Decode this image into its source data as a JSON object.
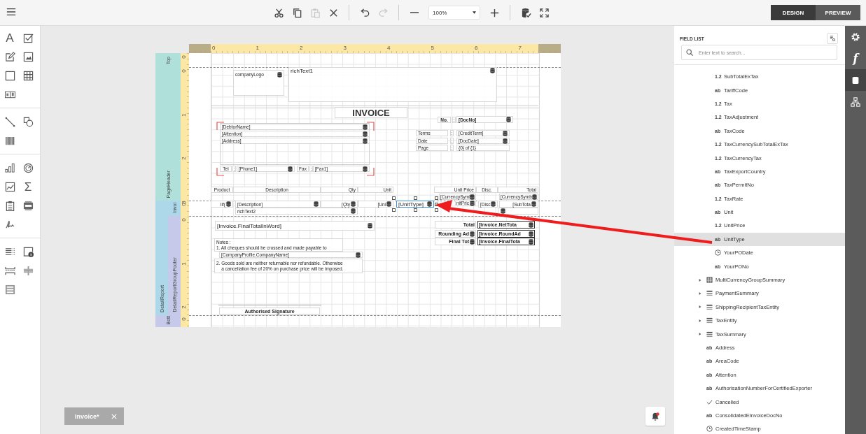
{
  "toolbar": [
    {
      "buttons": [
        {
          "kind": "cut",
          "disabled": false
        },
        {
          "kind": "copy",
          "disabled": false
        },
        {
          "kind": "paste",
          "disabled": true
        },
        {
          "kind": "delete",
          "disabled": false
        }
      ]
    },
    {
      "buttons": [
        {
          "kind": "undo",
          "disabled": false
        },
        {
          "kind": "redo",
          "disabled": true
        }
      ]
    },
    {
      "buttons": [
        {
          "kind": "zoom-out",
          "disabled": false
        },
        {
          "kind": "zoom",
          "value": "100%"
        },
        {
          "kind": "zoom-in",
          "disabled": false
        }
      ]
    },
    {
      "buttons": [
        {
          "kind": "validate",
          "disabled": false
        },
        {
          "kind": "fullscreen",
          "disabled": false
        }
      ]
    }
  ],
  "mode_tabs": [
    {
      "label": "DESIGN",
      "selected": true
    },
    {
      "label": "PREVIEW",
      "selected": false
    }
  ],
  "toolbox": [
    {
      "tools": [
        {
          "kind": "label",
          "glyph": "A"
        },
        {
          "kind": "checkbox"
        },
        {
          "kind": "richtext"
        },
        {
          "kind": "picture"
        },
        {
          "kind": "panel"
        },
        {
          "kind": "table"
        },
        {
          "kind": "comb"
        }
      ]
    },
    {
      "tools": [
        {
          "kind": "line"
        },
        {
          "kind": "shape"
        },
        {
          "kind": "barcode"
        }
      ]
    },
    {
      "tools": [
        {
          "kind": "chart"
        },
        {
          "kind": "gauge"
        },
        {
          "kind": "sparkline"
        },
        {
          "kind": "sum",
          "glyph": "Σ"
        },
        {
          "kind": "clipboard"
        },
        {
          "kind": "pdf"
        },
        {
          "kind": "signature"
        }
      ]
    },
    {
      "tools": [
        {
          "kind": "toc"
        },
        {
          "kind": "info"
        },
        {
          "kind": "pagebreak"
        },
        {
          "kind": "crossline"
        },
        {
          "kind": "crossbox"
        }
      ]
    }
  ],
  "report": {
    "h_ruler": [
      "0",
      "1",
      "2",
      "3",
      "4",
      "5",
      "6",
      "7"
    ],
    "bands": [
      {
        "label": "Top",
        "color": "#b0e0da",
        "ruler": [
          "0"
        ]
      },
      {
        "label": "PageHeader",
        "color": "#b0e0da",
        "ruler": [
          "0",
          "1",
          "2",
          "3"
        ]
      },
      {
        "label": "DetailReport",
        "color": "#acd8ea",
        "children": [
          {
            "label": "Invoi",
            "color": "#acd8ea",
            "ruler": [
              "0"
            ]
          },
          {
            "label": "DetailReportGroupFooter",
            "color": "#c6c9ea",
            "ruler": [
              "0",
              "1",
              "2"
            ]
          }
        ]
      },
      {
        "label": "Bott",
        "color": "#c6c9ea",
        "ruler": [
          "0"
        ]
      }
    ],
    "controls": [
      {
        "text": "companyLogo",
        "bound": true,
        "selected": false
      },
      {
        "text": "richText1",
        "bound": true,
        "selected": false
      },
      {
        "text": "INVOICE",
        "bound": false,
        "selected": false
      },
      {
        "text": "No.",
        "bound": false,
        "selected": false
      },
      {
        "text": ":",
        "bound": false,
        "selected": false
      },
      {
        "text": "[DocNo]",
        "bound": true,
        "selected": false
      },
      {
        "text": "[DebtorName]",
        "bound": true,
        "selected": false
      },
      {
        "text": "[Attention]",
        "bound": true,
        "selected": false
      },
      {
        "text": "[Address]",
        "bound": true,
        "selected": false
      },
      {
        "text": "Terms",
        "bound": false,
        "selected": false
      },
      {
        "text": ":",
        "bound": false,
        "selected": false
      },
      {
        "text": "[CreditTerm]",
        "bound": true,
        "selected": false
      },
      {
        "text": "Date",
        "bound": false,
        "selected": false
      },
      {
        "text": ":",
        "bound": false,
        "selected": false
      },
      {
        "text": "[DocDate]",
        "bound": true,
        "selected": false
      },
      {
        "text": "Page",
        "bound": false,
        "selected": false
      },
      {
        "text": ":",
        "bound": false,
        "selected": false
      },
      {
        "text": "{0} of {1}",
        "bound": false,
        "selected": false
      },
      {
        "text": "Tel",
        "bound": false,
        "selected": false
      },
      {
        "text": ":",
        "bound": false,
        "selected": false
      },
      {
        "text": "[Phone1]",
        "bound": true,
        "selected": false
      },
      {
        "text": "Fax",
        "bound": false,
        "selected": false
      },
      {
        "text": ":",
        "bound": false,
        "selected": false
      },
      {
        "text": "[Fax1]",
        "bound": true,
        "selected": false
      },
      {
        "text": "Product",
        "bound": false,
        "selected": false
      },
      {
        "text": "Description",
        "bound": false,
        "selected": false
      },
      {
        "text": "Qty",
        "bound": false,
        "selected": false
      },
      {
        "text": "Unit",
        "bound": false,
        "selected": false
      },
      {
        "text": "Unit Price",
        "bound": false,
        "selected": false
      },
      {
        "text": "Disc.",
        "bound": false,
        "selected": false
      },
      {
        "text": "Total",
        "bound": false,
        "selected": false
      },
      {
        "text": "[CurrencySymb",
        "bound": true,
        "selected": false
      },
      {
        "text": "[CurrencySymb",
        "bound": true,
        "selected": false
      },
      {
        "text": "Iif(",
        "bound": true,
        "selected": false
      },
      {
        "text": "[Description]",
        "bound": true,
        "selected": false
      },
      {
        "text": "[Qty",
        "bound": true,
        "selected": false
      },
      {
        "text": "[Uni",
        "bound": true,
        "selected": false
      },
      {
        "text": "[UnitType]",
        "bound": true,
        "selected": true
      },
      {
        "text": "nitPric",
        "bound": true,
        "selected": false
      },
      {
        "text": "[Disc",
        "bound": true,
        "selected": false
      },
      {
        "text": "[SubTota",
        "bound": true,
        "selected": false
      },
      {
        "text": "richText2",
        "bound": true,
        "selected": false
      },
      {
        "bound": true,
        "selected": false
      },
      {
        "text": "[Invoice.FinalTotalInWord]",
        "bound": true,
        "selected": false
      },
      {
        "text": "Total",
        "bound": false,
        "selected": false
      },
      {
        "text": "[Invoice.NetTota",
        "bound": true,
        "selected": false
      },
      {
        "text": "Rounding Ad",
        "bound": true,
        "selected": false
      },
      {
        "text": "[Invoice.RoundAd",
        "bound": true,
        "selected": false
      },
      {
        "text": "Notes :\n1. All cheques should be crossed and made payable to",
        "bound": false,
        "selected": false
      },
      {
        "text": "Final Tot",
        "bound": true,
        "selected": false
      },
      {
        "text": "[Invoice.FinalTota",
        "bound": true,
        "selected": false
      },
      {
        "text": "[CompanyProfile.CompanyName]",
        "bound": true,
        "selected": false
      },
      {
        "text": "2. Goods sold are neither returnable nor refundable. Otherwise\n    a cancellation fee of 20% on purchase price will be imposed.",
        "bound": false,
        "selected": false
      },
      {
        "text": "Authorised Signature",
        "bound": false,
        "selected": false
      }
    ]
  },
  "document_tab": {
    "label": "Invoice*"
  },
  "field_list": {
    "title": "FIELD LIST",
    "search": {
      "placeholder": "Enter text to search..."
    },
    "tree": [
      {
        "children": [
          {
            "kind": "number",
            "badge": "1.2",
            "label": "SubTotalExTax",
            "selected": false
          },
          {
            "kind": "string",
            "badge": "ab",
            "label": "TariffCode",
            "selected": false
          },
          {
            "kind": "number",
            "badge": "1.2",
            "label": "Tax",
            "selected": false
          },
          {
            "kind": "number",
            "badge": "1.2",
            "label": "TaxAdjustment",
            "selected": false
          },
          {
            "kind": "string",
            "badge": "ab",
            "label": "TaxCode",
            "selected": false
          },
          {
            "kind": "number",
            "badge": "1.2",
            "label": "TaxCurrencySubTotalExTax",
            "selected": false
          },
          {
            "kind": "number",
            "badge": "1.2",
            "label": "TaxCurrencyTax",
            "selected": false
          },
          {
            "kind": "string",
            "badge": "ab",
            "label": "TaxExportCountry",
            "selected": false
          },
          {
            "kind": "string",
            "badge": "ab",
            "label": "TaxPermitNo",
            "selected": false
          },
          {
            "kind": "number",
            "badge": "1.2",
            "label": "TaxRate",
            "selected": false
          },
          {
            "kind": "string",
            "badge": "ab",
            "label": "Unit",
            "selected": false
          },
          {
            "kind": "number",
            "badge": "1.2",
            "label": "UnitPrice",
            "selected": false
          },
          {
            "kind": "string",
            "badge": "ab",
            "label": "UnitType",
            "selected": true
          },
          {
            "kind": "date",
            "label": "YourPODate",
            "selected": false
          },
          {
            "kind": "string",
            "badge": "ab",
            "label": "YourPONo",
            "selected": false
          }
        ]
      },
      {
        "kind": "table",
        "label": "MultiCurrencyGroupSummary",
        "expanded": false,
        "selected": false
      },
      {
        "kind": "list",
        "label": "PaymentSummary",
        "expanded": false,
        "selected": false
      },
      {
        "kind": "list",
        "label": "ShippingRecipientTaxEntity",
        "expanded": false,
        "selected": false
      },
      {
        "kind": "list",
        "label": "TaxEntity",
        "expanded": false,
        "selected": false
      },
      {
        "kind": "list",
        "label": "TaxSummary",
        "expanded": false,
        "selected": false
      },
      {
        "kind": "string",
        "badge": "ab",
        "label": "Address",
        "selected": false
      },
      {
        "kind": "string",
        "badge": "ab",
        "label": "AreaCode",
        "selected": false
      },
      {
        "kind": "string",
        "badge": "ab",
        "label": "Attention",
        "selected": false
      },
      {
        "kind": "string",
        "badge": "ab",
        "label": "AuthorisationNumberForCertifiedExporter",
        "selected": false
      },
      {
        "kind": "boolean",
        "label": "Cancelled",
        "selected": false
      },
      {
        "kind": "string",
        "badge": "ab",
        "label": "ConsolidatedEInvoiceDocNo",
        "selected": false
      },
      {
        "kind": "date",
        "label": "CreatedTimeStamp",
        "selected": false
      }
    ]
  },
  "side_tabs": [
    {
      "kind": "settings",
      "selected": false
    },
    {
      "kind": "function",
      "glyph": "f",
      "selected": false
    },
    {
      "kind": "data",
      "selected": true
    },
    {
      "kind": "structure",
      "selected": false
    }
  ]
}
